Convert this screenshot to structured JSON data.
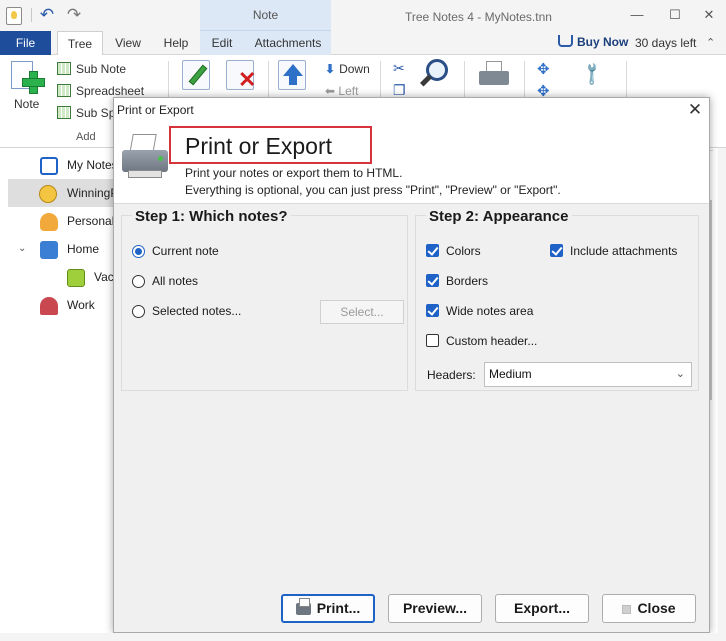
{
  "app": {
    "title": "Tree Notes 4 - MyNotes.tnn",
    "contextual_group": "Note"
  },
  "tabs": {
    "file": "File",
    "tree": "Tree",
    "view": "View",
    "help": "Help",
    "edit": "Edit",
    "attachments": "Attachments"
  },
  "license": {
    "buy_now": "Buy Now",
    "days_left": "30 days left"
  },
  "ribbon": {
    "note": "Note",
    "sub_note": "Sub Note",
    "spreadsheet": "Spreadsheet",
    "sub_spreadsheet": "Sub Spr",
    "add_group": "Add",
    "down": "Down",
    "left": "Left"
  },
  "tree": {
    "items": [
      {
        "label": "My Notes",
        "icon": "document-list-icon"
      },
      {
        "label": "WinningP",
        "icon": "clock-folder-icon"
      },
      {
        "label": "Personal",
        "icon": "person-icon"
      },
      {
        "label": "Home",
        "icon": "building-icon"
      },
      {
        "label": "Vac",
        "icon": "suitcase-icon"
      },
      {
        "label": "Work",
        "icon": "stamp-icon"
      }
    ]
  },
  "dialog": {
    "window_title": "Print or Export",
    "header_title": "Print or Export",
    "header_line1": "Print your notes or export them to HTML.",
    "header_line2": "Everything is optional, you can just press \"Print\", \"Preview\" or \"Export\".",
    "step1": {
      "title": "Step 1: Which notes?",
      "options": [
        {
          "label": "Current note",
          "selected": true
        },
        {
          "label": "All notes",
          "selected": false
        },
        {
          "label": "Selected notes...",
          "selected": false
        }
      ],
      "select_button": "Select..."
    },
    "step2": {
      "title": "Step 2: Appearance",
      "checks": {
        "colors": {
          "label": "Colors",
          "checked": true
        },
        "include_attachments": {
          "label": "Include attachments",
          "checked": true
        },
        "borders": {
          "label": "Borders",
          "checked": true
        },
        "wide_notes_area": {
          "label": "Wide notes area",
          "checked": true
        },
        "custom_header": {
          "label": "Custom header...",
          "checked": false
        }
      },
      "headers_label": "Headers:",
      "headers_value": "Medium"
    },
    "buttons": {
      "print": "Print...",
      "preview": "Preview...",
      "export": "Export...",
      "close": "Close"
    }
  },
  "colors": {
    "accent": "#1e62c7",
    "file_tab": "#1e4d9b",
    "title_highlight": "#d6333b",
    "contextual_tab": "#dde8f7"
  }
}
